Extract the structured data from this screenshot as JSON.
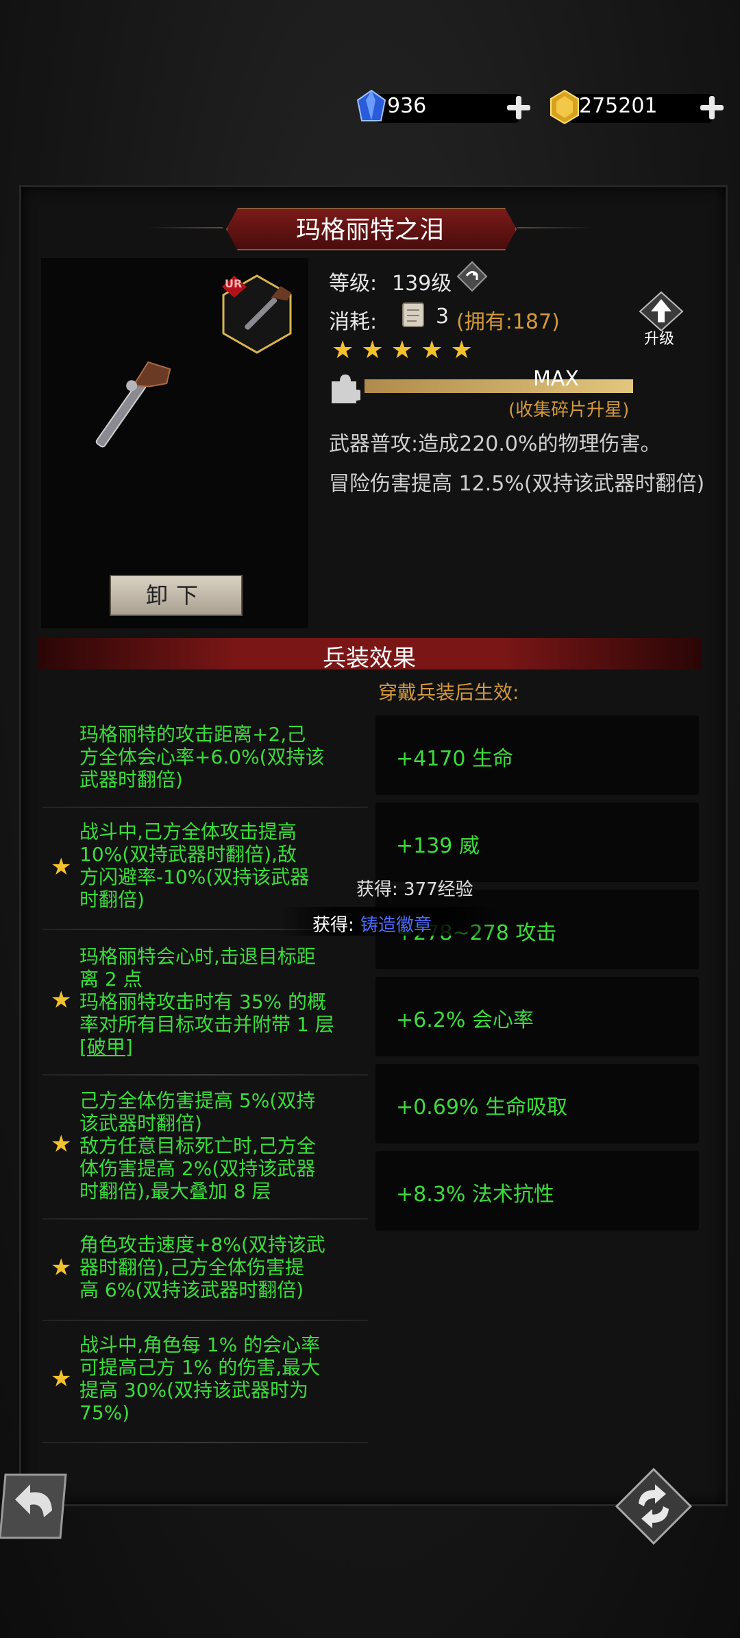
{
  "currency": {
    "gems": "936",
    "gold": "275201"
  },
  "weapon": {
    "name": "玛格丽特之泪",
    "rarity_badge": "UR",
    "level_label": "等级:",
    "level_value": "139级",
    "cost_label": "消耗:",
    "cost_value": "3",
    "owned": "(拥有:187)",
    "upgrade_label": "升级",
    "stars": 5,
    "progress_text": "MAX",
    "progress_fraction": 1.0,
    "progress_hint": "(收集碎片升星)",
    "attack_desc": "武器普攻:造成220.0%的物理伤害。",
    "adventure_desc": "冒险伤害提高 12.5%(双持该武器时翻倍)",
    "unequip_label": "卸下"
  },
  "section": {
    "title": "兵装效果",
    "subtitle": "穿戴兵装后生效:"
  },
  "effects": [
    {
      "starred": false,
      "lines": [
        "玛格丽特的攻击距离+2,己",
        "方全体会心率+6.0%(双持该",
        "武器时翻倍)"
      ]
    },
    {
      "starred": true,
      "lines": [
        "战斗中,己方全体攻击提高",
        "10%(双持武器时翻倍),敌",
        "方闪避率-10%(双持该武器",
        "时翻倍)"
      ]
    },
    {
      "starred": true,
      "lines": [
        "玛格丽特会心时,击退目标距",
        "离 2 点",
        "玛格丽特攻击时有 35% 的概",
        "率对所有目标攻击并附带 1 层",
        "[破甲]"
      ]
    },
    {
      "starred": true,
      "lines": [
        "己方全体伤害提高 5%(双持",
        "该武器时翻倍)",
        "敌方任意目标死亡时,己方全",
        "体伤害提高 2%(双持该武器",
        "时翻倍),最大叠加 8 层"
      ]
    },
    {
      "starred": true,
      "lines": [
        "角色攻击速度+8%(双持该武",
        "器时翻倍),己方全体伤害提",
        "高 6%(双持该武器时翻倍)"
      ]
    },
    {
      "starred": true,
      "lines": [
        "战斗中,角色每 1% 的会心率",
        "可提高己方 1% 的伤害,最大",
        "提高 30%(双持该武器时为",
        "75%)"
      ]
    }
  ],
  "stats": [
    "+4170 生命",
    "+139 威",
    "+278~278 攻击",
    "+6.2% 会心率",
    "+0.69% 生命吸取",
    "+8.3% 法术抗性"
  ],
  "toasts": {
    "exp": "获得: 377经验",
    "item_prefix": "获得:",
    "item_name": "铸造徽章"
  },
  "colors": {
    "effect_text": "#3cdc3c",
    "gold_text": "#d49a3c",
    "star": "#f3c12d",
    "banner_red": "#7a1616"
  }
}
